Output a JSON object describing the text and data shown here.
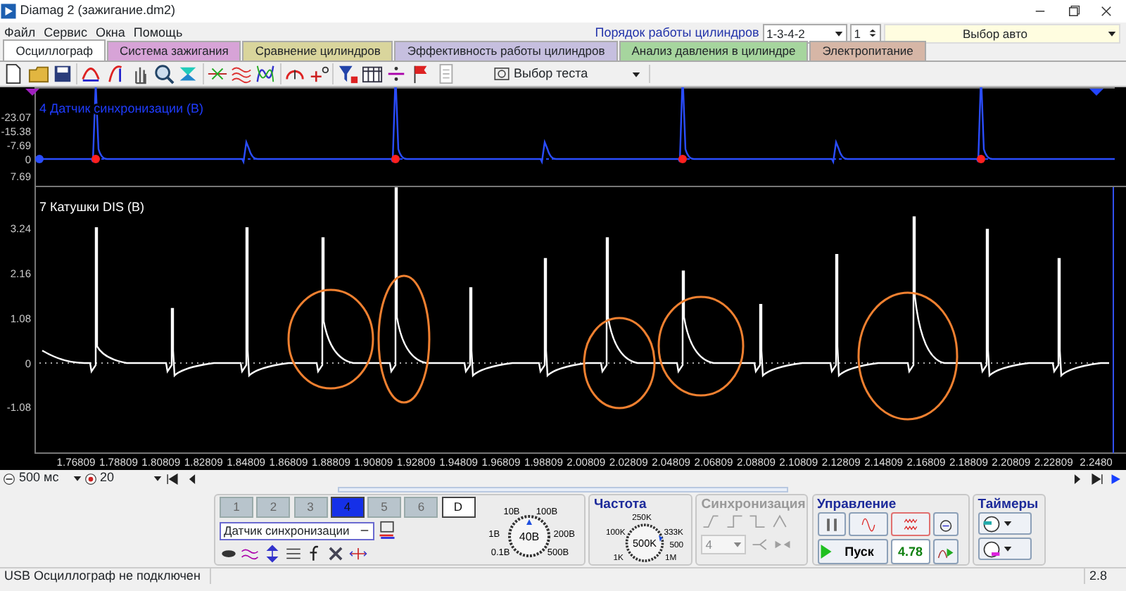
{
  "window": {
    "title": "Diamag 2 (зажигание.dm2)"
  },
  "menu": [
    "Файл",
    "Сервис",
    "Окна",
    "Помощь"
  ],
  "cylinder_order": {
    "label": "Порядок работы цилиндров",
    "value": "1-3-4-2",
    "spin_value": "1"
  },
  "car_select": {
    "value": "Выбор авто"
  },
  "tabs": [
    {
      "label": "Осциллограф",
      "selected": true,
      "color": "#f4f4f4"
    },
    {
      "label": "Система зажигания",
      "selected": false,
      "color": "#d7a3d7"
    },
    {
      "label": "Сравнение цилиндров",
      "selected": false,
      "color": "#d9d59c"
    },
    {
      "label": "Эффективность работы цилиндров",
      "selected": false,
      "color": "#c6bfdf"
    },
    {
      "label": "Анализ давления в цилиндре",
      "selected": false,
      "color": "#a6d59e"
    },
    {
      "label": "Электропитание",
      "selected": false,
      "color": "#d6b6a6"
    }
  ],
  "toolbar": {
    "test_select": "Выбор теста"
  },
  "sync_chart": {
    "title": "4 Датчик синхронизации (В)",
    "y_ticks": [
      "-23.07",
      "-15.38",
      "-7.69",
      "0",
      "7.69"
    ]
  },
  "main_chart": {
    "title": "7 Катушки DIS (В)",
    "y_ticks": [
      "3.24",
      "2.16",
      "1.08",
      "0",
      "-1.08"
    ],
    "x_ticks": [
      "1.76809",
      "1.78809",
      "1.80809",
      "1.82809",
      "1.84809",
      "1.86809",
      "1.88809",
      "1.90809",
      "1.92809",
      "1.94809",
      "1.96809",
      "1.98809",
      "2.00809",
      "2.02809",
      "2.04809",
      "2.06809",
      "2.08809",
      "2.10809",
      "2.12809",
      "2.14809",
      "2.16809",
      "2.18809",
      "2.20809",
      "2.22809",
      "2.2480"
    ]
  },
  "timebase": {
    "value": "500 мс"
  },
  "frames": {
    "value": "20"
  },
  "channel_buttons": [
    {
      "label": "1",
      "selected": false,
      "disabled": true
    },
    {
      "label": "2",
      "selected": false,
      "disabled": true
    },
    {
      "label": "3",
      "selected": false,
      "disabled": true
    },
    {
      "label": "4",
      "selected": true,
      "disabled": false
    },
    {
      "label": "5",
      "selected": false,
      "disabled": true
    },
    {
      "label": "6",
      "selected": false,
      "disabled": true
    },
    {
      "label": "D",
      "selected": false,
      "disabled": false
    }
  ],
  "channel_select": {
    "value": "Датчик синхронизации"
  },
  "voltage_knob": {
    "value": "40В",
    "labels": [
      "10В",
      "100В",
      "1В",
      "200В",
      "0.1В",
      "500В"
    ]
  },
  "frequency": {
    "title": "Частота",
    "value": "500K",
    "labels": [
      "250K",
      "100K",
      "333K",
      "500",
      "1K",
      "1M"
    ]
  },
  "sync": {
    "title": "Синхронизация",
    "disabled": true,
    "select": "4"
  },
  "control": {
    "title": "Управление",
    "start": "Пуск",
    "reading": "4.78"
  },
  "timers": {
    "title": "Таймеры"
  },
  "status_bar": {
    "message": "USB Осциллограф не подключен",
    "version": "2.8"
  }
}
